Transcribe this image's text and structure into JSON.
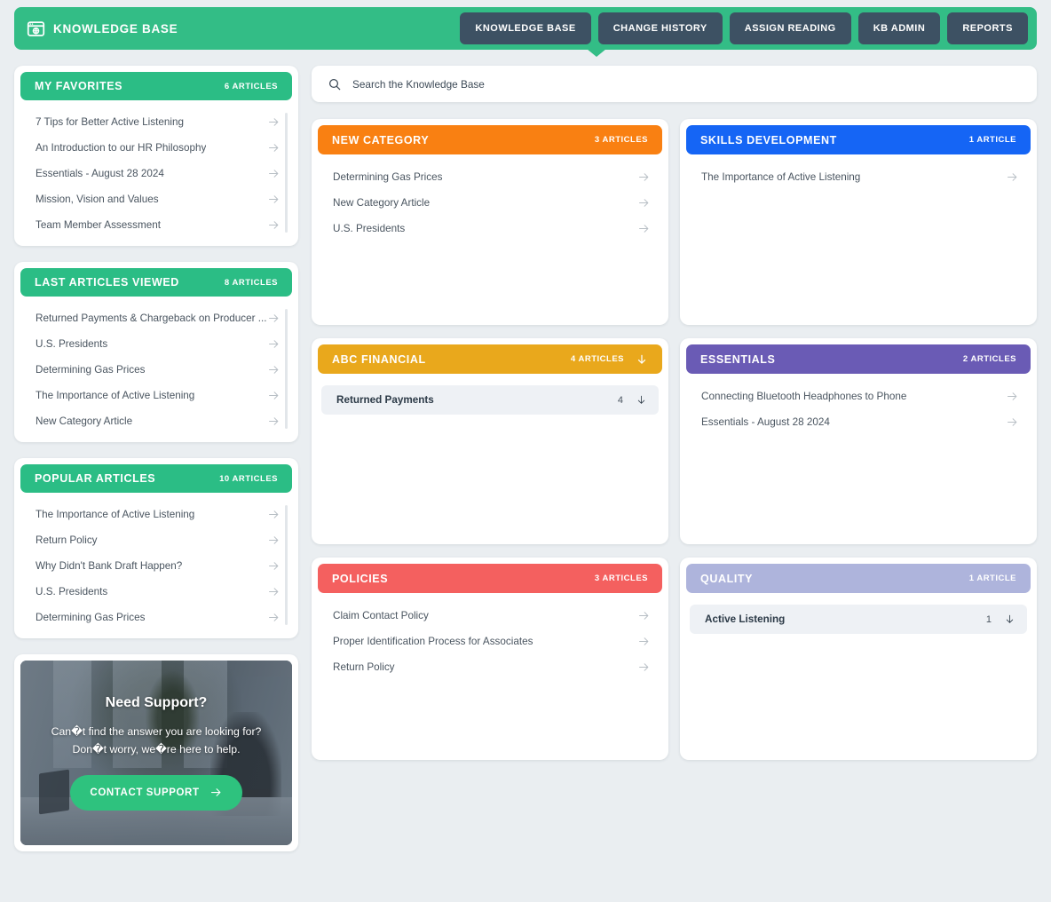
{
  "header": {
    "brand": "KNOWLEDGE BASE",
    "brand_icon": "browser-globe-icon",
    "background_color": "#33bd86",
    "tabs": [
      {
        "label": "KNOWLEDGE BASE",
        "active": true
      },
      {
        "label": "CHANGE HISTORY",
        "active": false
      },
      {
        "label": "ASSIGN READING",
        "active": false
      },
      {
        "label": "KB ADMIN",
        "active": false
      },
      {
        "label": "REPORTS",
        "active": false
      }
    ]
  },
  "search": {
    "placeholder": "Search the Knowledge Base",
    "value": "",
    "icon": "search-icon"
  },
  "sidebar": {
    "panels": [
      {
        "title": "MY FAVORITES",
        "count": "6 ARTICLES",
        "color": "#2bbd85",
        "items": [
          "7 Tips for Better Active Listening",
          "An Introduction to our HR Philosophy",
          "Essentials - August 28 2024",
          "Mission, Vision and Values",
          "Team Member Assessment"
        ]
      },
      {
        "title": "LAST ARTICLES VIEWED",
        "count": "8 ARTICLES",
        "color": "#2bbd85",
        "items": [
          "Returned Payments & Chargeback on Producer ...",
          "U.S. Presidents",
          "Determining Gas Prices",
          "The Importance of Active Listening",
          "New Category Article"
        ]
      },
      {
        "title": "POPULAR ARTICLES",
        "count": "10 ARTICLES",
        "color": "#2bbd85",
        "items": [
          "The Importance of Active Listening",
          "Return Policy",
          "Why Didn't Bank Draft Happen?",
          "U.S. Presidents",
          "Determining Gas Prices"
        ]
      }
    ],
    "support": {
      "title": "Need Support?",
      "body": "Can�t find the answer you are looking for? Don�t worry, we�re here to help.",
      "button_label": "CONTACT SUPPORT",
      "button_icon": "arrow-right-icon",
      "button_color": "#2ec27e"
    }
  },
  "categories": [
    {
      "title": "NEW CATEGORY",
      "count": "3 ARTICLES",
      "color": "#f98012",
      "has_download": false,
      "items": [
        {
          "label": "Determining Gas Prices",
          "type": "article"
        },
        {
          "label": "New Category Article",
          "type": "article"
        },
        {
          "label": "U.S. Presidents",
          "type": "article"
        }
      ]
    },
    {
      "title": "SKILLS DEVELOPMENT",
      "count": "1 ARTICLE",
      "color": "#1565f5",
      "has_download": false,
      "items": [
        {
          "label": "The Importance of Active Listening",
          "type": "article"
        }
      ]
    },
    {
      "title": "ABC FINANCIAL",
      "count": "4 ARTICLES",
      "color": "#e9a81c",
      "has_download": true,
      "items": [
        {
          "label": "Returned Payments",
          "type": "folder",
          "num": "4"
        }
      ]
    },
    {
      "title": "ESSENTIALS",
      "count": "2 ARTICLES",
      "color": "#6a5bb5",
      "has_download": false,
      "items": [
        {
          "label": "Connecting Bluetooth Headphones to Phone",
          "type": "article"
        },
        {
          "label": "Essentials - August 28 2024",
          "type": "article"
        }
      ]
    },
    {
      "title": "POLICIES",
      "count": "3 ARTICLES",
      "color": "#f4605f",
      "has_download": false,
      "items": [
        {
          "label": "Claim Contact Policy",
          "type": "article"
        },
        {
          "label": "Proper Identification Process for Associates",
          "type": "article"
        },
        {
          "label": "Return Policy",
          "type": "article"
        }
      ]
    },
    {
      "title": "QUALITY",
      "count": "1 ARTICLE",
      "color": "#aeb4dc",
      "has_download": false,
      "items": [
        {
          "label": "Active Listening",
          "type": "folder",
          "num": "1"
        }
      ]
    }
  ]
}
